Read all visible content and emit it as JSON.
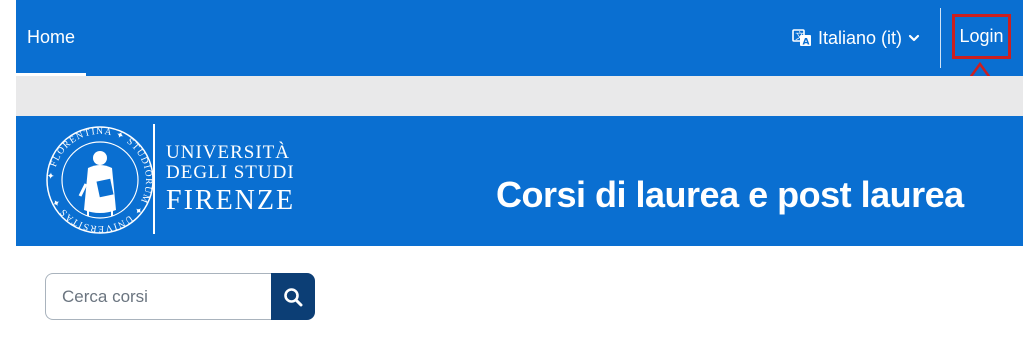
{
  "navbar": {
    "home_label": "Home",
    "language_label": "Italiano (it)",
    "language_icon": "translate-icon",
    "login_label": "Login",
    "bg_color": "#0a6fd1"
  },
  "annotation": {
    "highlight_color": "#cc1f1f",
    "arrow_icon": "arrow-up-outline-icon"
  },
  "banner": {
    "logo_lines": [
      "UNIVERSITÀ",
      "DEGLI STUDI",
      "FIRENZE"
    ],
    "seal_text": "FLORENTINA STUDIORUM UNIVERSITAS",
    "title": "Corsi di laurea e post laurea",
    "bg_color": "#0a6fd1"
  },
  "search": {
    "placeholder": "Cerca corsi",
    "button_icon": "search-icon",
    "button_color": "#0c3e75"
  }
}
